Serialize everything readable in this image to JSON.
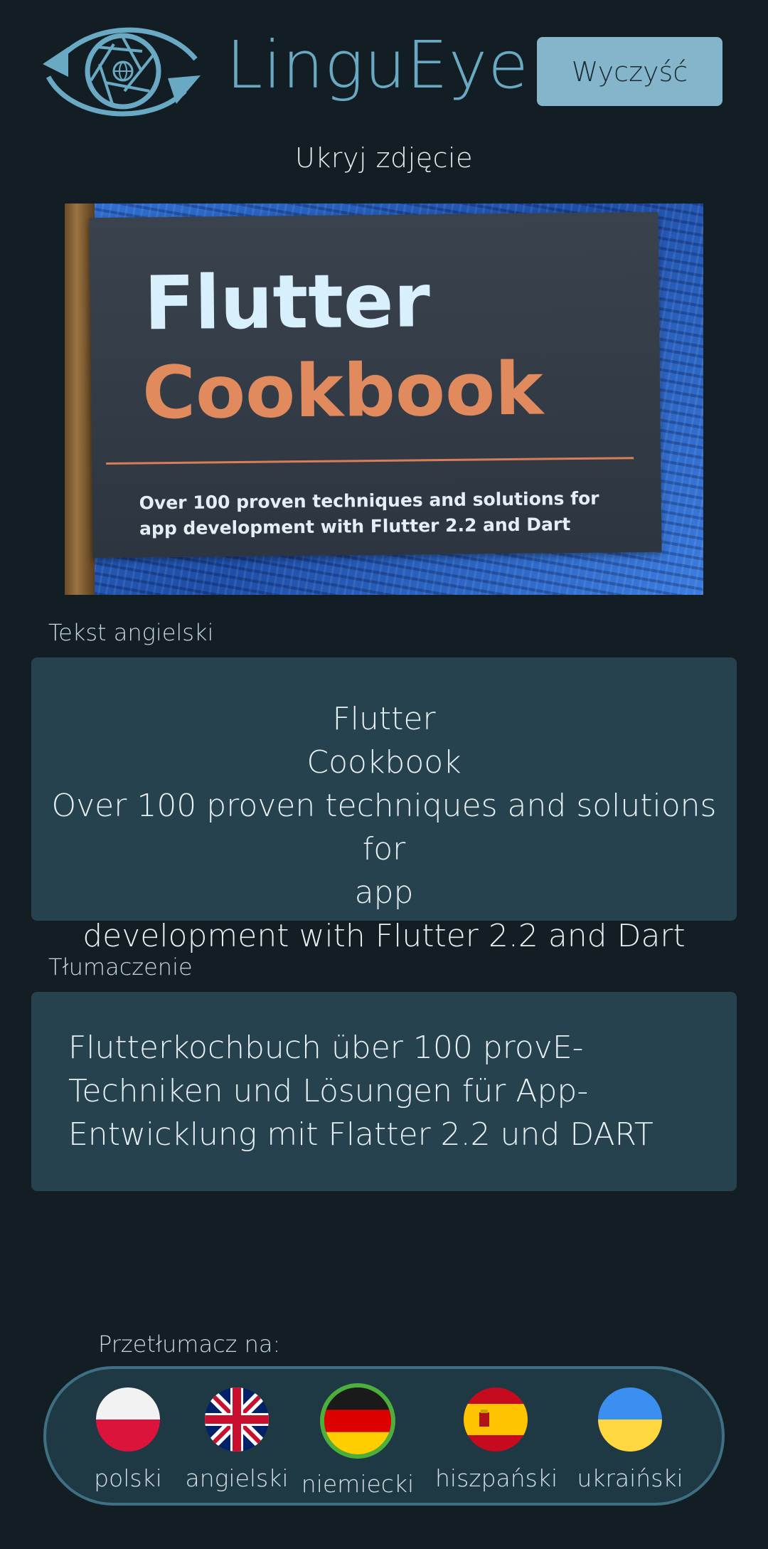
{
  "header": {
    "app_name": "LinguEye",
    "clear_button": "Wyczyść",
    "hide_photo": "Ukryj zdjęcie"
  },
  "photo": {
    "title_line1": "Flutter",
    "title_line2": "Cookbook",
    "subtitle": "Over 100 proven techniques and solutions for app development with Flutter 2.2 and Dart"
  },
  "source": {
    "label": "Tekst angielski",
    "lines": [
      "Flutter",
      "Cookbook",
      "Over 100 proven techniques and solutions for",
      "app",
      "development with Flutter 2.2 and Dart"
    ]
  },
  "translation": {
    "label": "Tłumaczenie",
    "text": "Flutterkochbuch über 100 provE-Techniken und Lösungen für App-Entwicklung mit Flatter 2.2 und DART"
  },
  "target_languages": {
    "label": "Przetłumacz na:",
    "selected": "niemiecki",
    "items": [
      {
        "label": "polski",
        "icon": "poland-flag-icon"
      },
      {
        "label": "angielski",
        "icon": "uk-flag-icon"
      },
      {
        "label": "niemiecki",
        "icon": "germany-flag-icon"
      },
      {
        "label": "hiszpański",
        "icon": "spain-flag-icon"
      },
      {
        "label": "ukraiński",
        "icon": "ukraine-flag-icon"
      }
    ]
  },
  "colors": {
    "background": "#121e24",
    "brand": "#6aa9c4",
    "button": "#84b5cb",
    "card": "#25424e",
    "selected_ring": "#4caf3c"
  }
}
